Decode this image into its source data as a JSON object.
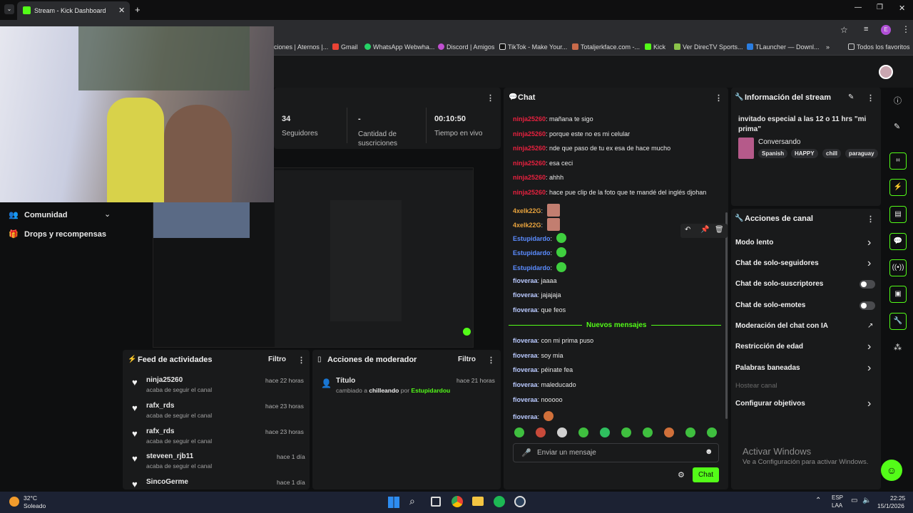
{
  "browser": {
    "tab_title": "Stream - Kick Dashboard",
    "bookmarks": [
      "ciones | Aternos |...",
      "Gmail",
      "WhatsApp Webwha...",
      "Discord | Amigos",
      "TikTok - Make Your...",
      "Totaljerkface.com -...",
      "Kick",
      "Ver DirecTV Sports...",
      "TLauncher — Downl..."
    ],
    "all_favorites": "Todos los favoritos",
    "profile_letter": "E"
  },
  "stats": [
    {
      "value": "34",
      "label": "Seguidores"
    },
    {
      "value": "-",
      "label": "Cantidad de suscriciones"
    },
    {
      "value": "00:10:50",
      "label": "Tiempo en vivo"
    }
  ],
  "sidebar": {
    "comunidad": "Comunidad",
    "drops": "Drops y recompensas"
  },
  "chat": {
    "title": "Chat",
    "messages": [
      {
        "user": "ninja25260",
        "text": "mañana te sigo",
        "cls": "u-ninja"
      },
      {
        "user": "ninja25260",
        "text": "porque este no es mi celular",
        "cls": "u-ninja"
      },
      {
        "user": "ninja25260",
        "text": "nde que paso de tu ex esa de hace mucho",
        "cls": "u-ninja"
      },
      {
        "user": "ninja25260",
        "text": "esa ceci",
        "cls": "u-ninja"
      },
      {
        "user": "ninja25260",
        "text": "ahhh",
        "cls": "u-ninja"
      },
      {
        "user": "ninja25260",
        "text": "hace pue clip de la foto que te mandé del inglés djohan",
        "cls": "u-ninja"
      },
      {
        "user": "4xelk22G",
        "text": "",
        "cls": "u-4x"
      },
      {
        "user": "4xelk22G",
        "text": "",
        "cls": "u-4x"
      },
      {
        "user": "Estupidardo",
        "text": "",
        "cls": "u-est"
      },
      {
        "user": "Estupidardo",
        "text": "",
        "cls": "u-est"
      },
      {
        "user": "Estupidardo",
        "text": "",
        "cls": "u-est"
      },
      {
        "user": "fioveraa",
        "text": "jaaaa",
        "cls": "u-fio"
      },
      {
        "user": "fioveraa",
        "text": "jajajaja",
        "cls": "u-fio"
      },
      {
        "user": "fioveraa",
        "text": "que feos",
        "cls": "u-fio"
      }
    ],
    "new_messages": "Nuevos mensajes",
    "messages2": [
      {
        "user": "fioveraa",
        "text": "con mi prima puso"
      },
      {
        "user": "fioveraa",
        "text": "soy mia"
      },
      {
        "user": "fioveraa",
        "text": "péinate fea"
      },
      {
        "user": "fioveraa",
        "text": "maleducado"
      },
      {
        "user": "fioveraa",
        "text": "nooooo"
      },
      {
        "user": "fioveraa",
        "text": ""
      }
    ],
    "input_placeholder": "Enviar un mensaje",
    "send_label": "Chat"
  },
  "stream_info": {
    "title": "Información del stream",
    "stream_title": "invitado especial a las 12 o 11 hrs \"mi prima\"",
    "category": "Conversando",
    "tags": [
      "Spanish",
      "HAPPY",
      "chill",
      "paraguay"
    ]
  },
  "channel_actions": {
    "title": "Acciones de canal",
    "items": [
      {
        "label": "Modo lento",
        "kind": "chevron"
      },
      {
        "label": "Chat de solo-seguidores",
        "kind": "chevron"
      },
      {
        "label": "Chat de solo-suscriptores",
        "kind": "toggle"
      },
      {
        "label": "Chat de solo-emotes",
        "kind": "toggle"
      },
      {
        "label": "Moderación del chat con IA",
        "kind": "external"
      },
      {
        "label": "Restricción de edad",
        "kind": "chevron"
      },
      {
        "label": "Palabras baneadas",
        "kind": "chevron"
      },
      {
        "label": "Hostear canal",
        "kind": "disabled"
      },
      {
        "label": "Configurar objetivos",
        "kind": "chevron"
      }
    ]
  },
  "activation": {
    "title": "Activar Windows",
    "sub": "Ve a Configuración para activar Windows."
  },
  "feed": {
    "title": "Feed de actividades",
    "filter": "Filtro",
    "items": [
      {
        "name": "ninja25260",
        "sub": "acaba de seguir el canal",
        "time": "hace 22 horas"
      },
      {
        "name": "rafx_rds",
        "sub": "acaba de seguir el canal",
        "time": "hace 23 horas"
      },
      {
        "name": "rafx_rds",
        "sub": "acaba de seguir el canal",
        "time": "hace 23 horas"
      },
      {
        "name": "steveen_rjb11",
        "sub": "acaba de seguir el canal",
        "time": "hace 1 día"
      },
      {
        "name": "SincoGerme",
        "sub": "",
        "time": "hace 1 día"
      }
    ]
  },
  "mod": {
    "title": "Acciones de moderador",
    "filter": "Filtro",
    "item_title": "Título",
    "time": "hace 21 horas",
    "pre": "cambiado a",
    "value": "chilleando",
    "by": "por",
    "moderator": "Estupidardou"
  },
  "taskbar": {
    "weather_temp": "32°C",
    "weather_desc": "Soleado",
    "lang1": "ESP",
    "lang2": "LAA",
    "time": "22:25",
    "date": "15/1/2026"
  }
}
